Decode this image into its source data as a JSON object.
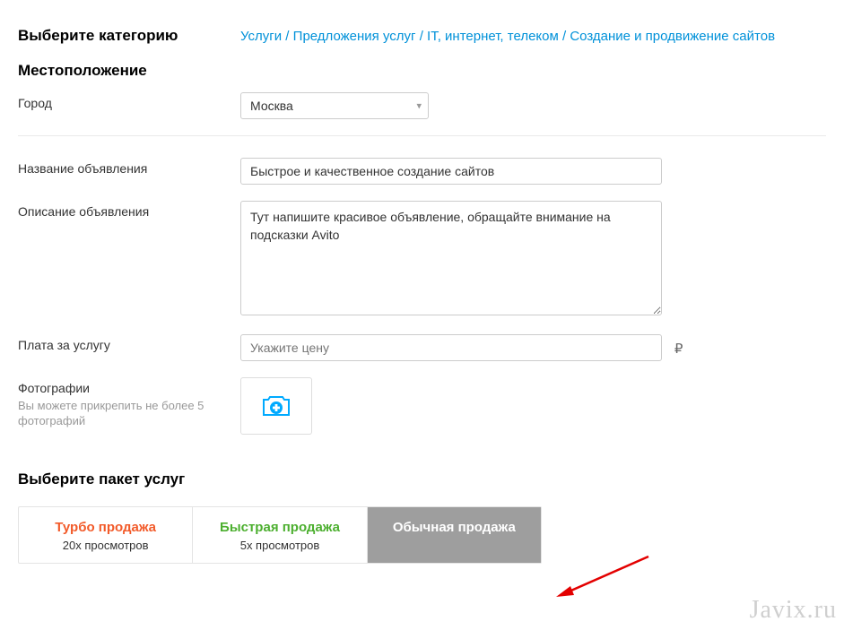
{
  "headings": {
    "select_category": "Выберите категорию",
    "location": "Местоположение",
    "select_package": "Выберите пакет услуг"
  },
  "breadcrumb": {
    "items": [
      "Услуги",
      "Предложения услуг",
      "IT, интернет, телеком",
      "Создание и продвижение сайтов"
    ],
    "separator": " / "
  },
  "labels": {
    "city": "Город",
    "ad_title": "Название объявления",
    "ad_description": "Описание объявления",
    "service_fee": "Плата за услугу",
    "photos": "Фотографии",
    "photos_hint": "Вы можете прикрепить не более 5 фотографий"
  },
  "fields": {
    "city_value": "Москва",
    "title_value": "Быстрое и качественное создание сайтов",
    "description_value": "Тут напишите красивое объявление, обращайте внимание на подсказки Avito",
    "price_placeholder": "Укажите цену",
    "currency_symbol": "₽"
  },
  "packages": {
    "turbo": {
      "title": "Турбо продажа",
      "sub": "20x просмотров"
    },
    "fast": {
      "title": "Быстрая продажа",
      "sub": "5x просмотров"
    },
    "normal": {
      "title": "Обычная продажа"
    }
  },
  "watermark": "Javix.ru"
}
